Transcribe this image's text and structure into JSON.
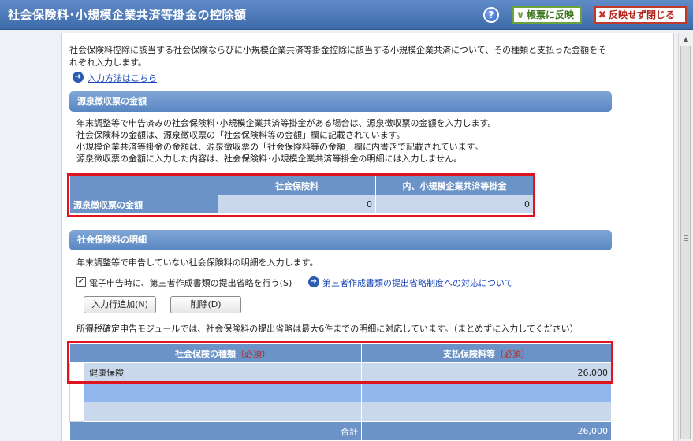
{
  "window": {
    "title": "社会保険料･小規模企業共済等掛金の控除額",
    "help_icon": "?",
    "apply_button": "帳票に反映",
    "close_button": "反映せず閉じる"
  },
  "intro": {
    "text": "社会保険料控除に該当する社会保険ならびに小規模企業共済等掛金控除に該当する小規模企業共済について、その種類と支払った金額をそれぞれ入力します。",
    "link": "入力方法はこちら"
  },
  "withholding": {
    "header": "源泉徴収票の金額",
    "desc": [
      "年末調整等で申告済みの社会保険料･小規模企業共済等掛金がある場合は、源泉徴収票の金額を入力します。",
      "社会保険料の金額は、源泉徴収票の「社会保険料等の金額」欄に記載されています。",
      "小規模企業共済等掛金の金額は、源泉徴収票の「社会保険料等の金額」欄に内書きで記載されています。",
      "源泉徴収票の金額に入力した内容は、社会保険料･小規模企業共済等掛金の明細には入力しません。"
    ],
    "table": {
      "col1": "社会保険料",
      "col2": "内、小規模企業共済等掛金",
      "row_label": "源泉徴収票の金額",
      "val1": "0",
      "val2": "0"
    }
  },
  "details": {
    "header": "社会保険料の明細",
    "desc": "年末調整等で申告していない社会保険料の明細を入力します。",
    "checkbox_label": "電子申告時に、第三者作成書類の提出省略を行う(S)",
    "checkbox_mark": "✓",
    "link": "第三者作成書類の提出省略制度への対応について",
    "add_button": "入力行追加(N)",
    "delete_button": "削除(D)",
    "note": "所得税確定申告モジュールでは、社会保険料の提出省略は最大6件までの明細に対応しています。（まとめずに入力してください）",
    "table": {
      "col1": "社会保険の種類",
      "col2": "支払保険料等",
      "required": "（必須）",
      "rows": [
        {
          "type": "健康保険",
          "amount": "26,000"
        },
        {
          "type": "",
          "amount": ""
        },
        {
          "type": "",
          "amount": ""
        }
      ],
      "total_label": "合計",
      "total_value": "26,000"
    }
  }
}
